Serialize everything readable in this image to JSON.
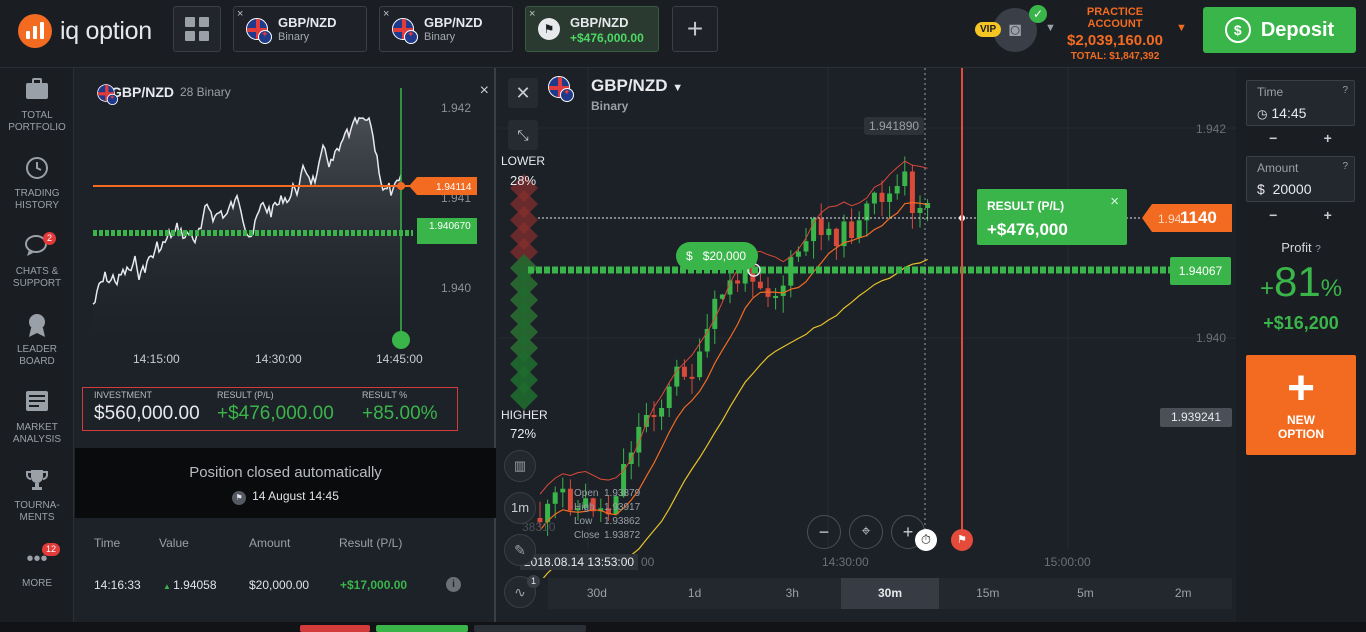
{
  "brand": {
    "name": "iq option",
    "color": "#f26b21"
  },
  "tabs": [
    {
      "name": "GBP/NZD",
      "sub": "Binary",
      "close": "×"
    },
    {
      "name": "GBP/NZD",
      "sub": "Binary",
      "close": "×"
    },
    {
      "name": "GBP/NZD",
      "sub": "+$476,000.00",
      "close": "×",
      "active": true
    }
  ],
  "plus_tab": "+",
  "account": {
    "vip": "VIP",
    "label": "PRACTICE ACCOUNT",
    "balance": "$2,039,160.00",
    "total": "TOTAL: $1,847,392",
    "caret": "▼"
  },
  "deposit": {
    "label": "Deposit",
    "icon": "$"
  },
  "nav": [
    {
      "label1": "TOTAL",
      "label2": "PORTFOLIO",
      "icon": "briefcase-icon"
    },
    {
      "label1": "TRADING",
      "label2": "HISTORY",
      "icon": "history-icon"
    },
    {
      "label1": "CHATS &",
      "label2": "SUPPORT",
      "icon": "chat-icon",
      "badge": "2"
    },
    {
      "label1": "LEADER",
      "label2": "BOARD",
      "icon": "leaderboard-icon"
    },
    {
      "label1": "MARKET",
      "label2": "ANALYSIS",
      "icon": "market-icon"
    },
    {
      "label1": "TOURNA-",
      "label2": "MENTS",
      "icon": "trophy-icon"
    },
    {
      "label1": "MORE",
      "label2": "",
      "icon": "more-icon",
      "badge": "12"
    }
  ],
  "mini_chart": {
    "asset": "GBP/NZD",
    "sub": "28 Binary",
    "close": "×",
    "y_labels": [
      "1.942",
      "1.941",
      "1.940"
    ],
    "x_labels": [
      "14:15:00",
      "14:30:00",
      "14:45:00"
    ],
    "orange_tag": "1.94114",
    "green_tag": "1.940670"
  },
  "investment": {
    "inv_label": "INVESTMENT",
    "inv_value": "$560,000.00",
    "res_label": "RESULT (P/L)",
    "res_value": "+$476,000.00",
    "pct_label": "RESULT %",
    "pct_value": "+85.00%"
  },
  "closed": {
    "title": "Position closed automatically",
    "date": "14 August 14:45"
  },
  "table": {
    "headers": [
      "Time",
      "Value",
      "Amount",
      "Result (P/L)"
    ],
    "rows": [
      {
        "time": "14:16:33",
        "value": "1.94058",
        "amount": "$20,000.00",
        "result": "+$17,000.00",
        "info": "i"
      }
    ]
  },
  "chart": {
    "asset": "GBP/NZD",
    "sub": "Binary",
    "lower_label": "LOWER",
    "lower_pct": "28%",
    "higher_label": "HIGHER",
    "higher_pct": "72%",
    "tooltip_price": "1.941890",
    "result_label": "RESULT (P/L)",
    "result_value": "+$476,000",
    "result_close": "×",
    "price_tag_small": "1.94",
    "price_tag_big": "1140",
    "green_tag": "1.94067",
    "gray_tag": "1.939241",
    "bet_label": "$20,000",
    "y_labels": [
      "1.942",
      "1.940"
    ],
    "partial_price": "38310",
    "x_labels": [
      "14:30:00",
      "15:00:00"
    ],
    "date_label": "2018.08.14 13:53:00",
    "date_suffix": "00",
    "interval": "1m",
    "indicator_badge": "1",
    "ohlc": {
      "open_l": "Open",
      "open": "1.93879",
      "high_l": "High",
      "high": "1.93917",
      "low_l": "Low",
      "low": "1.93862",
      "close_l": "Close",
      "close": "1.93872"
    },
    "zoom_minus": "−",
    "zoom_plus": "+",
    "timeframes": [
      "30d",
      "1d",
      "3h",
      "30m",
      "15m",
      "5m",
      "2m"
    ],
    "selected_tf": "30m"
  },
  "right_panel": {
    "time_label": "Time",
    "time_value": "14:45",
    "amount_label": "Amount",
    "amount_value": "$  20000",
    "help": "?",
    "minus": "−",
    "plus": "+",
    "profit_label": "Profit",
    "profit_pct": "81",
    "profit_pct_sign": "+",
    "profit_pct_unit": "%",
    "profit_value": "+$16,200",
    "new_option_line1": "NEW",
    "new_option_line2": "OPTION",
    "new_option_icon": "+"
  }
}
